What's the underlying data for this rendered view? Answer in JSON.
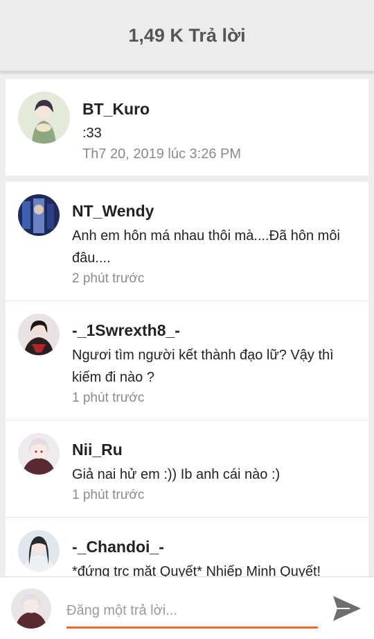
{
  "header": {
    "title": "1,49 K Trả lời"
  },
  "original_post": {
    "username": "BT_Kuro",
    "text": ":33",
    "timestamp": "Th7 20, 2019 lúc 3:26 PM",
    "avatar_icon": "user-avatar-icon"
  },
  "replies": [
    {
      "username": "NT_Wendy",
      "text": "Anh em hôn má nhau thôi mà....Đã hôn môi đâu....",
      "timestamp": "2 phút trước"
    },
    {
      "username": "-_1Swrexth8_-",
      "text": "Ngươi tìm người kết thành đạo lữ? Vậy thì kiếm đi nào ?",
      "timestamp": "1 phút trước"
    },
    {
      "username": "Nii_Ru",
      "text": "Giả nai hử em :)) Ib anh cái nào :)",
      "timestamp": "1 phút trước"
    },
    {
      "username": "-_Chandoi_-",
      "text": "*đứng trc mặt Quyết* Nhiếp Minh Quyết!",
      "timestamp": ""
    }
  ],
  "composer": {
    "placeholder": "Đăng một trả lời...",
    "send_icon": "send-icon"
  },
  "colors": {
    "accent": "#f26a2b",
    "header_bg": "#ececec",
    "page_bg": "#eeeeee"
  }
}
